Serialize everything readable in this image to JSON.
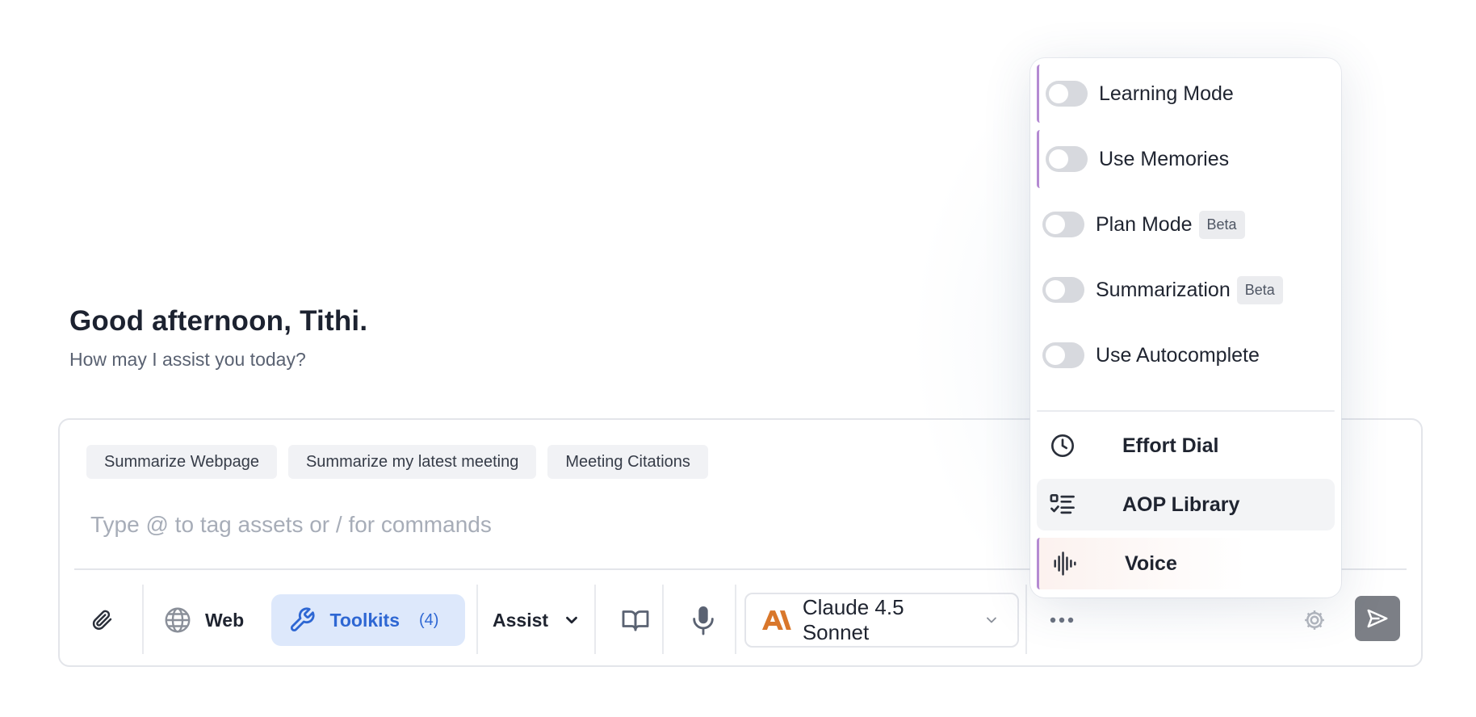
{
  "greeting": {
    "title": "Good afternoon, Tithi.",
    "subtitle": "How may I assist you today?"
  },
  "suggestions": [
    "Summarize Webpage",
    "Summarize my latest meeting",
    "Meeting Citations"
  ],
  "composer": {
    "placeholder": "Type @ to tag assets or / for commands",
    "value": ""
  },
  "toolbar": {
    "attach_icon": "paperclip-icon",
    "web_label": "Web",
    "toolkits_label": "Toolkits",
    "toolkits_count": "(4)",
    "assist_label": "Assist",
    "model_label": "Claude 4.5 Sonnet",
    "send_icon": "send-icon"
  },
  "menu": {
    "toggles": [
      {
        "label": "Learning Mode",
        "on": false
      },
      {
        "label": "Use Memories",
        "on": false
      },
      {
        "label": "Plan Mode",
        "badge": "Beta",
        "on": false
      },
      {
        "label": "Summarization",
        "badge": "Beta",
        "on": false
      },
      {
        "label": "Use Autocomplete",
        "on": false
      }
    ],
    "items": [
      {
        "label": "Effort Dial",
        "icon": "clock-icon"
      },
      {
        "label": "AOP Library",
        "icon": "checklist-icon"
      },
      {
        "label": "Voice",
        "icon": "waveform-icon"
      }
    ]
  },
  "colors": {
    "accent_blue": "#2e67d3",
    "toolkits_bg": "#dde8fb",
    "claude_orange": "#d9772b",
    "menu_accent": "#b48ad2",
    "send_bg": "#7c7f86"
  }
}
